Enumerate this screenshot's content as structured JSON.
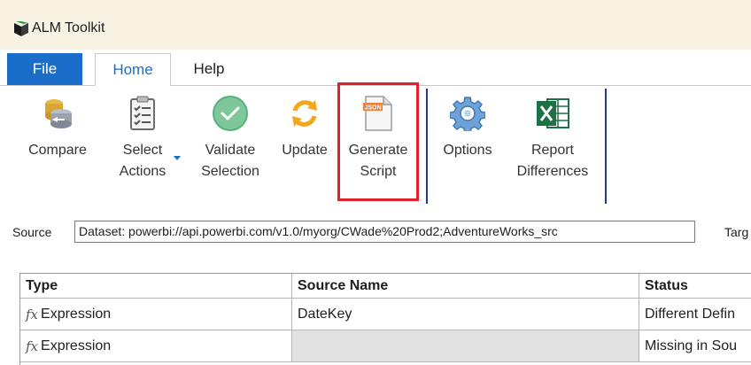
{
  "app": {
    "title": "ALM Toolkit"
  },
  "tabs": {
    "file": "File",
    "home": "Home",
    "help": "Help"
  },
  "ribbon": {
    "compare": [
      "Compare",
      ""
    ],
    "select_actions": [
      "Select",
      "Actions"
    ],
    "validate_selection": [
      "Validate",
      "Selection"
    ],
    "update": [
      "Update",
      ""
    ],
    "generate_script": [
      "Generate",
      "Script"
    ],
    "options": [
      "Options",
      ""
    ],
    "report_differences": [
      "Report",
      "Differences"
    ],
    "json_badge": "JSON"
  },
  "source": {
    "label": "Source",
    "value": "Dataset: powerbi://api.powerbi.com/v1.0/myorg/CWade%20Prod2;AdventureWorks_src"
  },
  "target": {
    "label": "Targ"
  },
  "grid": {
    "columns": [
      "Type",
      "Source Name",
      "Status"
    ],
    "fx_symbol": "fx",
    "rows": [
      {
        "type": "Expression",
        "source_name": "DateKey",
        "status": "Different Defin"
      },
      {
        "type": "Expression",
        "source_name": "",
        "status": "Missing in Sou"
      }
    ]
  }
}
